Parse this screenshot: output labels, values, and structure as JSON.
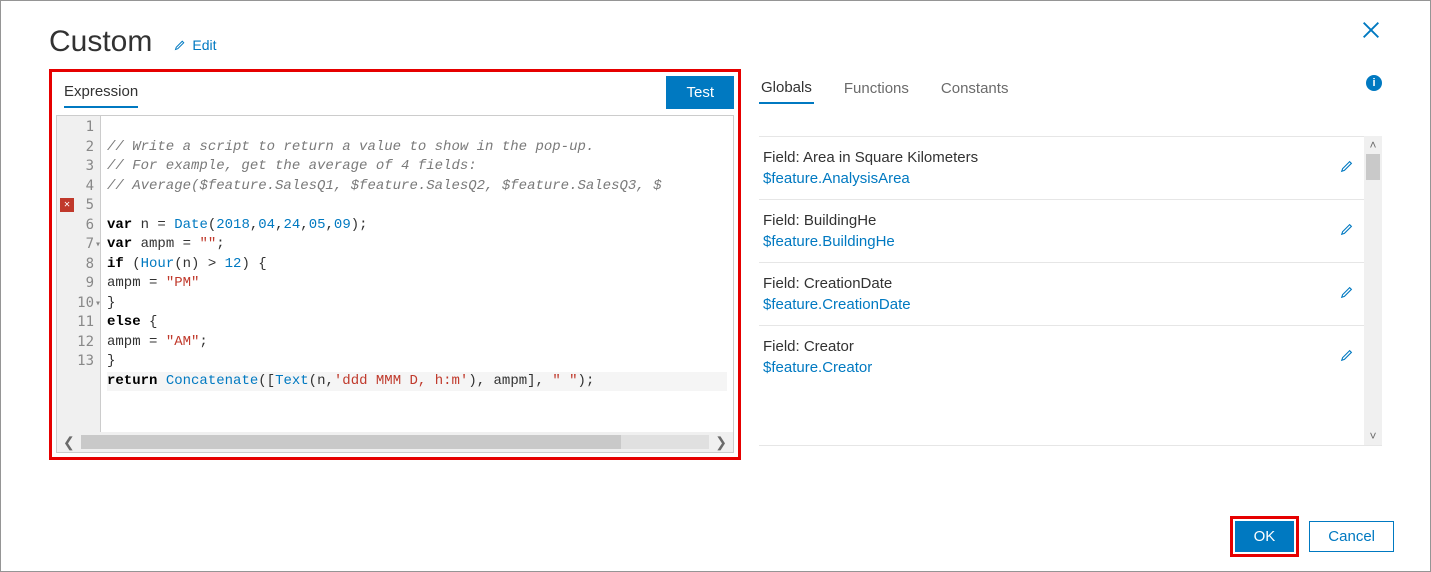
{
  "title": "Custom",
  "edit_label": "Edit",
  "left": {
    "tab_label": "Expression",
    "test_label": "Test"
  },
  "code": {
    "line1_comment": "// Write a script to return a value to show in the pop-up.",
    "line2_comment": "// For example, get the average of 4 fields:",
    "line3_comment": "// Average($feature.SalesQ1, $feature.SalesQ2, $feature.SalesQ3, $",
    "l5_a": "var",
    "l5_b": " n = ",
    "l5_c": "Date",
    "l5_d": "(",
    "l5_n1": "2018",
    "l5_n2": "04",
    "l5_n3": "24",
    "l5_n4": "05",
    "l5_n5": "09",
    "l5_e": ");",
    "l6_a": "var",
    "l6_b": " ampm = ",
    "l6_s": "\"\"",
    "l6_e": ";",
    "l7_a": "if",
    "l7_b": " (",
    "l7_c": "Hour",
    "l7_d": "(n) > ",
    "l7_n": "12",
    "l7_e": ") {",
    "l8_a": "ampm = ",
    "l8_s": "\"PM\"",
    "l9": "}",
    "l10_a": "else",
    "l10_b": " {",
    "l11_a": "ampm = ",
    "l11_s": "\"AM\"",
    "l11_e": ";",
    "l12": "}",
    "l13_a": "return",
    "l13_b": " ",
    "l13_c": "Concatenate",
    "l13_d": "([",
    "l13_e": "Text",
    "l13_f": "(n,",
    "l13_s": "'ddd MMM D, h:m'",
    "l13_g": "), ampm], ",
    "l13_h": "\" \"",
    "l13_i": ");"
  },
  "gutter": [
    "1",
    "2",
    "3",
    "4",
    "5",
    "6",
    "7",
    "8",
    "9",
    "10",
    "11",
    "12",
    "13"
  ],
  "right_tabs": {
    "globals": "Globals",
    "functions": "Functions",
    "constants": "Constants"
  },
  "info_glyph": "i",
  "globals": [
    {
      "label": "Field: Area in Square Kilometers",
      "token": "$feature.AnalysisArea"
    },
    {
      "label": "Field: BuildingHe",
      "token": "$feature.BuildingHe"
    },
    {
      "label": "Field: CreationDate",
      "token": "$feature.CreationDate"
    },
    {
      "label": "Field: Creator",
      "token": "$feature.Creator"
    }
  ],
  "footer": {
    "ok": "OK",
    "cancel": "Cancel"
  },
  "err_glyph": "✕",
  "comma": ","
}
